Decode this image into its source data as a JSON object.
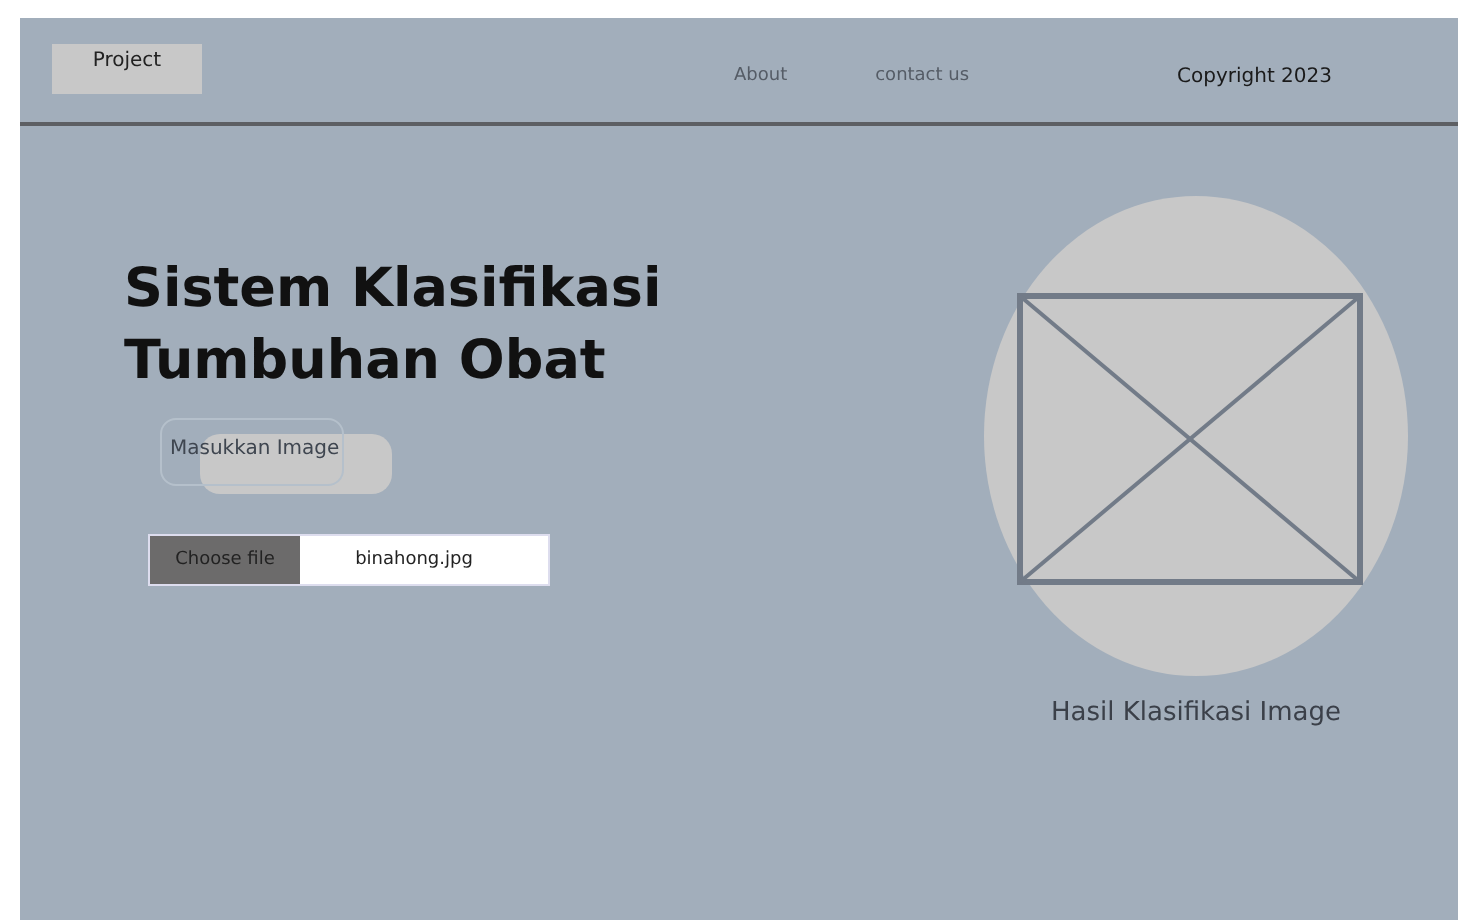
{
  "header": {
    "brand": "Project",
    "nav": [
      "About",
      "contact us"
    ],
    "copyright": "Copyright 2023"
  },
  "title": "Sistem Klasifikasi Tumbuhan Obat",
  "upload": {
    "label": "Masukkan Image",
    "button": "Choose file",
    "value": "binahong.jpg"
  },
  "result": {
    "caption": "Hasil Klasifikasi Image"
  }
}
